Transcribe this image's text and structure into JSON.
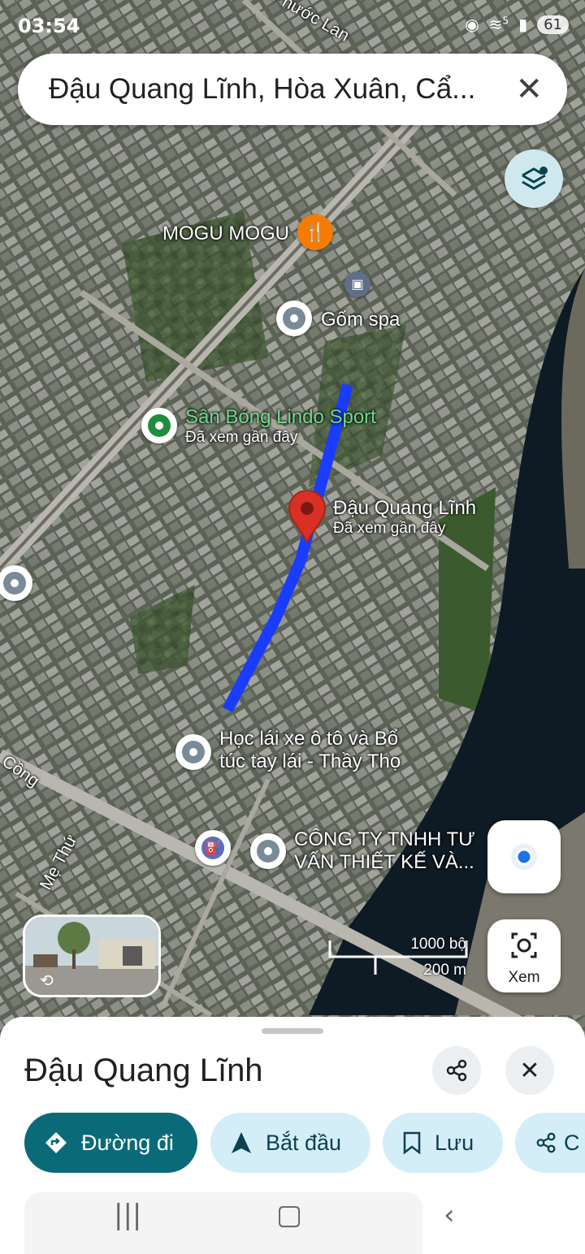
{
  "status_bar": {
    "time": "03:54",
    "wifi_label": "5",
    "battery": "61"
  },
  "search": {
    "query": "Đậu Quang Lĩnh, Hòa Xuân, Cẩ..."
  },
  "map": {
    "street_labels": [
      "Phước Lan",
      "Cồng",
      "Mẹ Thứ"
    ],
    "places": [
      {
        "name": "MOGU MOGU",
        "sub": ""
      },
      {
        "name": "Gốm spa",
        "sub": ""
      },
      {
        "name": "Sân Bóng Lindo Sport",
        "sub": "Đã xem gần đây"
      },
      {
        "name": "Đậu Quang Lĩnh",
        "sub": "Đã xem gần đây"
      },
      {
        "name": "Học lái xe ô tô và Bổ",
        "sub": "túc tay lái - Thầy Thọ"
      },
      {
        "name": "CÔNG TY TNHH TƯ",
        "sub": "VẤN THIẾT KẾ VÀ..."
      }
    ],
    "scale": {
      "imperial": "1000 bộ",
      "metric": "200 m"
    },
    "colors": {
      "route": "#1a3cff",
      "selected_pin": "#d93025",
      "river": "#0e1a24",
      "food_pin": "#f57c00",
      "sport_pin": "#1e8e3e",
      "fuel_pin": "#5c6bc0"
    }
  },
  "controls": {
    "lens_label": "Xem"
  },
  "sheet": {
    "title": "Đậu Quang Lĩnh",
    "actions": [
      {
        "label": "Đường đi",
        "icon": "directions-icon"
      },
      {
        "label": "Bắt đầu",
        "icon": "navigate-arrow-icon"
      },
      {
        "label": "Lưu",
        "icon": "bookmark-icon"
      },
      {
        "label": "C",
        "icon": "share-icon"
      }
    ]
  }
}
